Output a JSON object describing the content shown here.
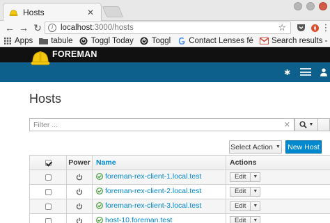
{
  "browser": {
    "tab_title": "Hosts",
    "url_host": "localhost",
    "url_rest": ":3000/hosts"
  },
  "bookmarks": [
    {
      "label": "Apps",
      "icon": "apps-grid-icon"
    },
    {
      "label": "tabule",
      "icon": "folder-icon"
    },
    {
      "label": "Toggl Today",
      "icon": "toggl-icon"
    },
    {
      "label": "Toggl",
      "icon": "toggl-icon"
    },
    {
      "label": "Contact Lenses fé",
      "icon": "google-icon"
    },
    {
      "label": "Search results - ",
      "icon": "gmail-icon"
    }
  ],
  "app": {
    "brand": "FOREMAN",
    "accent": "#0088ce",
    "header_bg": "#0d5f8c"
  },
  "page": {
    "title": "Hosts",
    "filter_placeholder": "Filter ...",
    "select_action": "Select Action",
    "new_host": "New Host"
  },
  "table": {
    "headers": {
      "power": "Power",
      "name": "Name",
      "actions": "Actions"
    },
    "rows": [
      {
        "name": "foreman-rex-client-1.local.test",
        "edit": "Edit"
      },
      {
        "name": "foreman-rex-client-2.local.test",
        "edit": "Edit"
      },
      {
        "name": "foreman-rex-client-3.local.test",
        "edit": "Edit"
      },
      {
        "name": "host-10.foreman.test",
        "edit": "Edit"
      }
    ]
  }
}
